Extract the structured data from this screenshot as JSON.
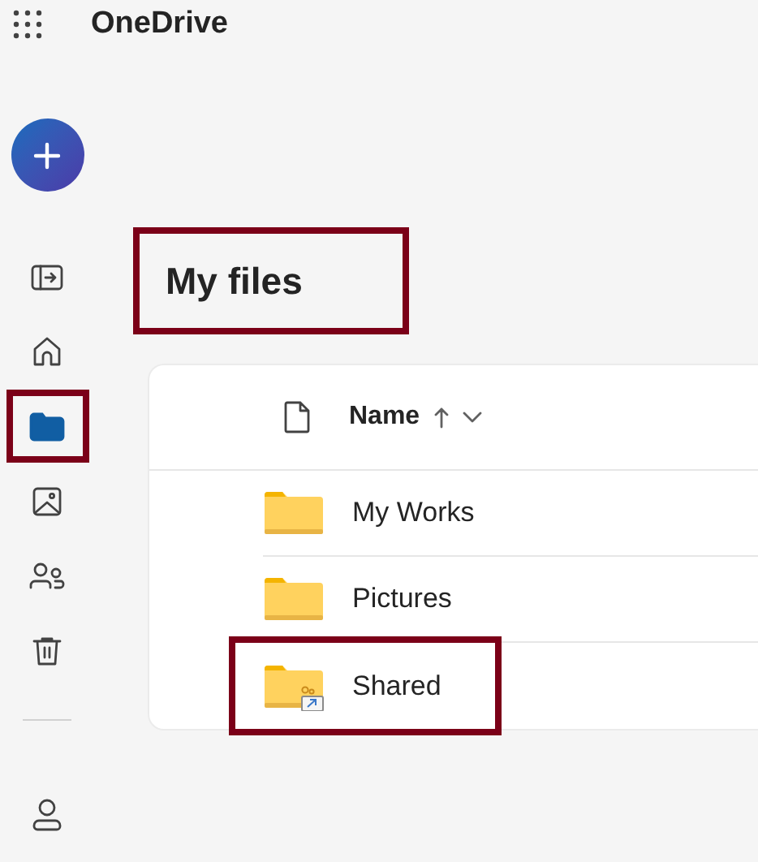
{
  "app": {
    "title": "OneDrive"
  },
  "nav": [
    {
      "kind": "collapse",
      "selected": false,
      "highlighted": false
    },
    {
      "kind": "home",
      "selected": false,
      "highlighted": false
    },
    {
      "kind": "files",
      "selected": true,
      "highlighted": true
    },
    {
      "kind": "photos",
      "selected": false,
      "highlighted": false
    },
    {
      "kind": "shared",
      "selected": false,
      "highlighted": false
    },
    {
      "kind": "trash",
      "selected": false,
      "highlighted": false
    }
  ],
  "page": {
    "title": "My files",
    "highlighted": true
  },
  "table": {
    "columns": [
      {
        "label": "Name",
        "sorted": true
      }
    ],
    "rows": [
      {
        "name": "My Works",
        "kind": "folder",
        "highlighted": false
      },
      {
        "name": "Pictures",
        "kind": "folder",
        "highlighted": false
      },
      {
        "name": "Shared",
        "kind": "shared-folder",
        "highlighted": true
      }
    ]
  }
}
